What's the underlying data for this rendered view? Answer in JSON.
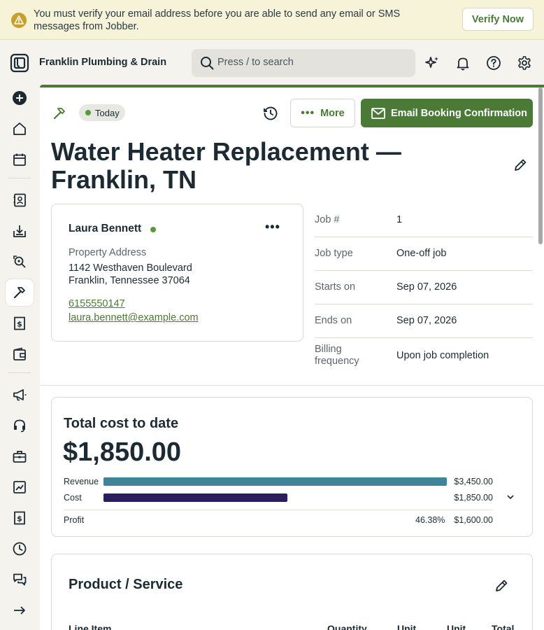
{
  "banner": {
    "message": "You must verify your email address before you are able to send any email or SMS messages from Jobber.",
    "verify_label": "Verify Now",
    "warning_color": "#c8a12b"
  },
  "topbar": {
    "company": "Franklin Plumbing & Drain",
    "search_placeholder": "Press / to search",
    "icons": [
      "sparkle-icon",
      "bell-icon",
      "help-icon",
      "settings-icon"
    ]
  },
  "sidebar": {
    "items": [
      "create",
      "home",
      "schedule",
      "clients",
      "requests",
      "quotes",
      "jobs",
      "invoices",
      "payments",
      "marketing",
      "support",
      "apps",
      "reports",
      "expenses",
      "timesheets",
      "chat",
      "collapse"
    ],
    "active": "jobs"
  },
  "job": {
    "status": "Today",
    "more_label": "More",
    "email_label": "Email Booking Confirmation",
    "title": "Water Heater Replacement — Franklin, TN"
  },
  "client": {
    "name": "Laura Bennett",
    "property_label": "Property Address",
    "address_line1": "1142 Westhaven Boulevard",
    "address_line2": "Franklin, Tennessee 37064",
    "phone": "6155550147",
    "email": "laura.bennett@example.com"
  },
  "details": [
    {
      "label": "Job #",
      "value": "1"
    },
    {
      "label": "Job type",
      "value": "One-off job"
    },
    {
      "label": "Starts on",
      "value": "Sep 07, 2026"
    },
    {
      "label": "Ends on",
      "value": "Sep 07, 2026"
    },
    {
      "label": "Billing frequency",
      "value": "Upon job completion"
    }
  ],
  "cost": {
    "title": "Total cost to date",
    "amount": "$1,850.00",
    "revenue_label": "Revenue",
    "revenue_value": "$3,450.00",
    "revenue_amount": 3450,
    "cost_label": "Cost",
    "cost_value": "$1,850.00",
    "cost_amount": 1850,
    "profit_label": "Profit",
    "profit_pct": "46.38%",
    "profit_value": "$1,600.00",
    "revenue_color": "#3f8499",
    "cost_color": "#2a1f5c"
  },
  "products": {
    "title": "Product / Service",
    "columns": [
      "Line Item",
      "Quantity",
      "Unit",
      "Unit",
      "Total"
    ]
  },
  "colors": {
    "brand_green": "#4a7a35",
    "status_dot": "#5b9a3a"
  }
}
